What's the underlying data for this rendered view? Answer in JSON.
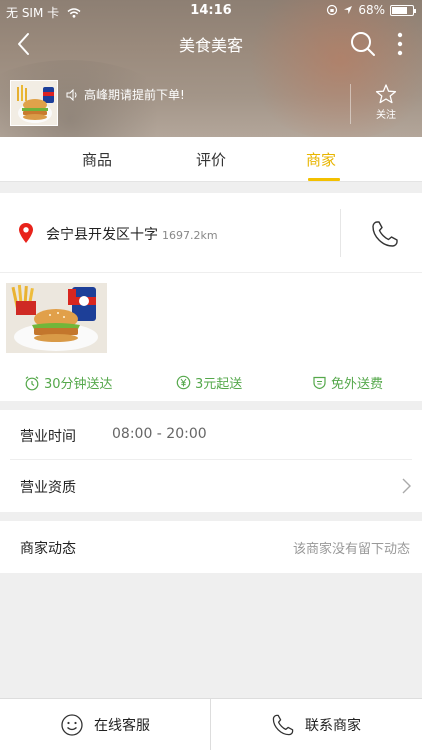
{
  "status_bar": {
    "carrier": "无 SIM 卡",
    "time": "14:16",
    "battery": "68%"
  },
  "header": {
    "title": "美食美客"
  },
  "shop": {
    "notice": "高峰期请提前下单!",
    "follow_label": "关注"
  },
  "tabs": [
    {
      "label": "商品"
    },
    {
      "label": "评价"
    },
    {
      "label": "商家"
    }
  ],
  "active_tab": "商家",
  "address": {
    "text": "会宁县开发区十字",
    "distance": "1697.2km"
  },
  "features": [
    {
      "label": "30分钟送达",
      "icon": "clock-icon"
    },
    {
      "label": "3元起送",
      "icon": "yuan-icon"
    },
    {
      "label": "免外送费",
      "icon": "free-delivery-icon"
    }
  ],
  "info": {
    "hours_label": "营业时间",
    "hours_value": "08:00 - 20:00",
    "license_label": "营业资质",
    "news_label": "商家动态",
    "news_value": "该商家没有留下动态"
  },
  "bottom": {
    "service_label": "在线客服",
    "contact_label": "联系商家"
  },
  "colors": {
    "accent": "#f3c000",
    "green": "#55a84b",
    "pin_red": "#e8231b"
  }
}
